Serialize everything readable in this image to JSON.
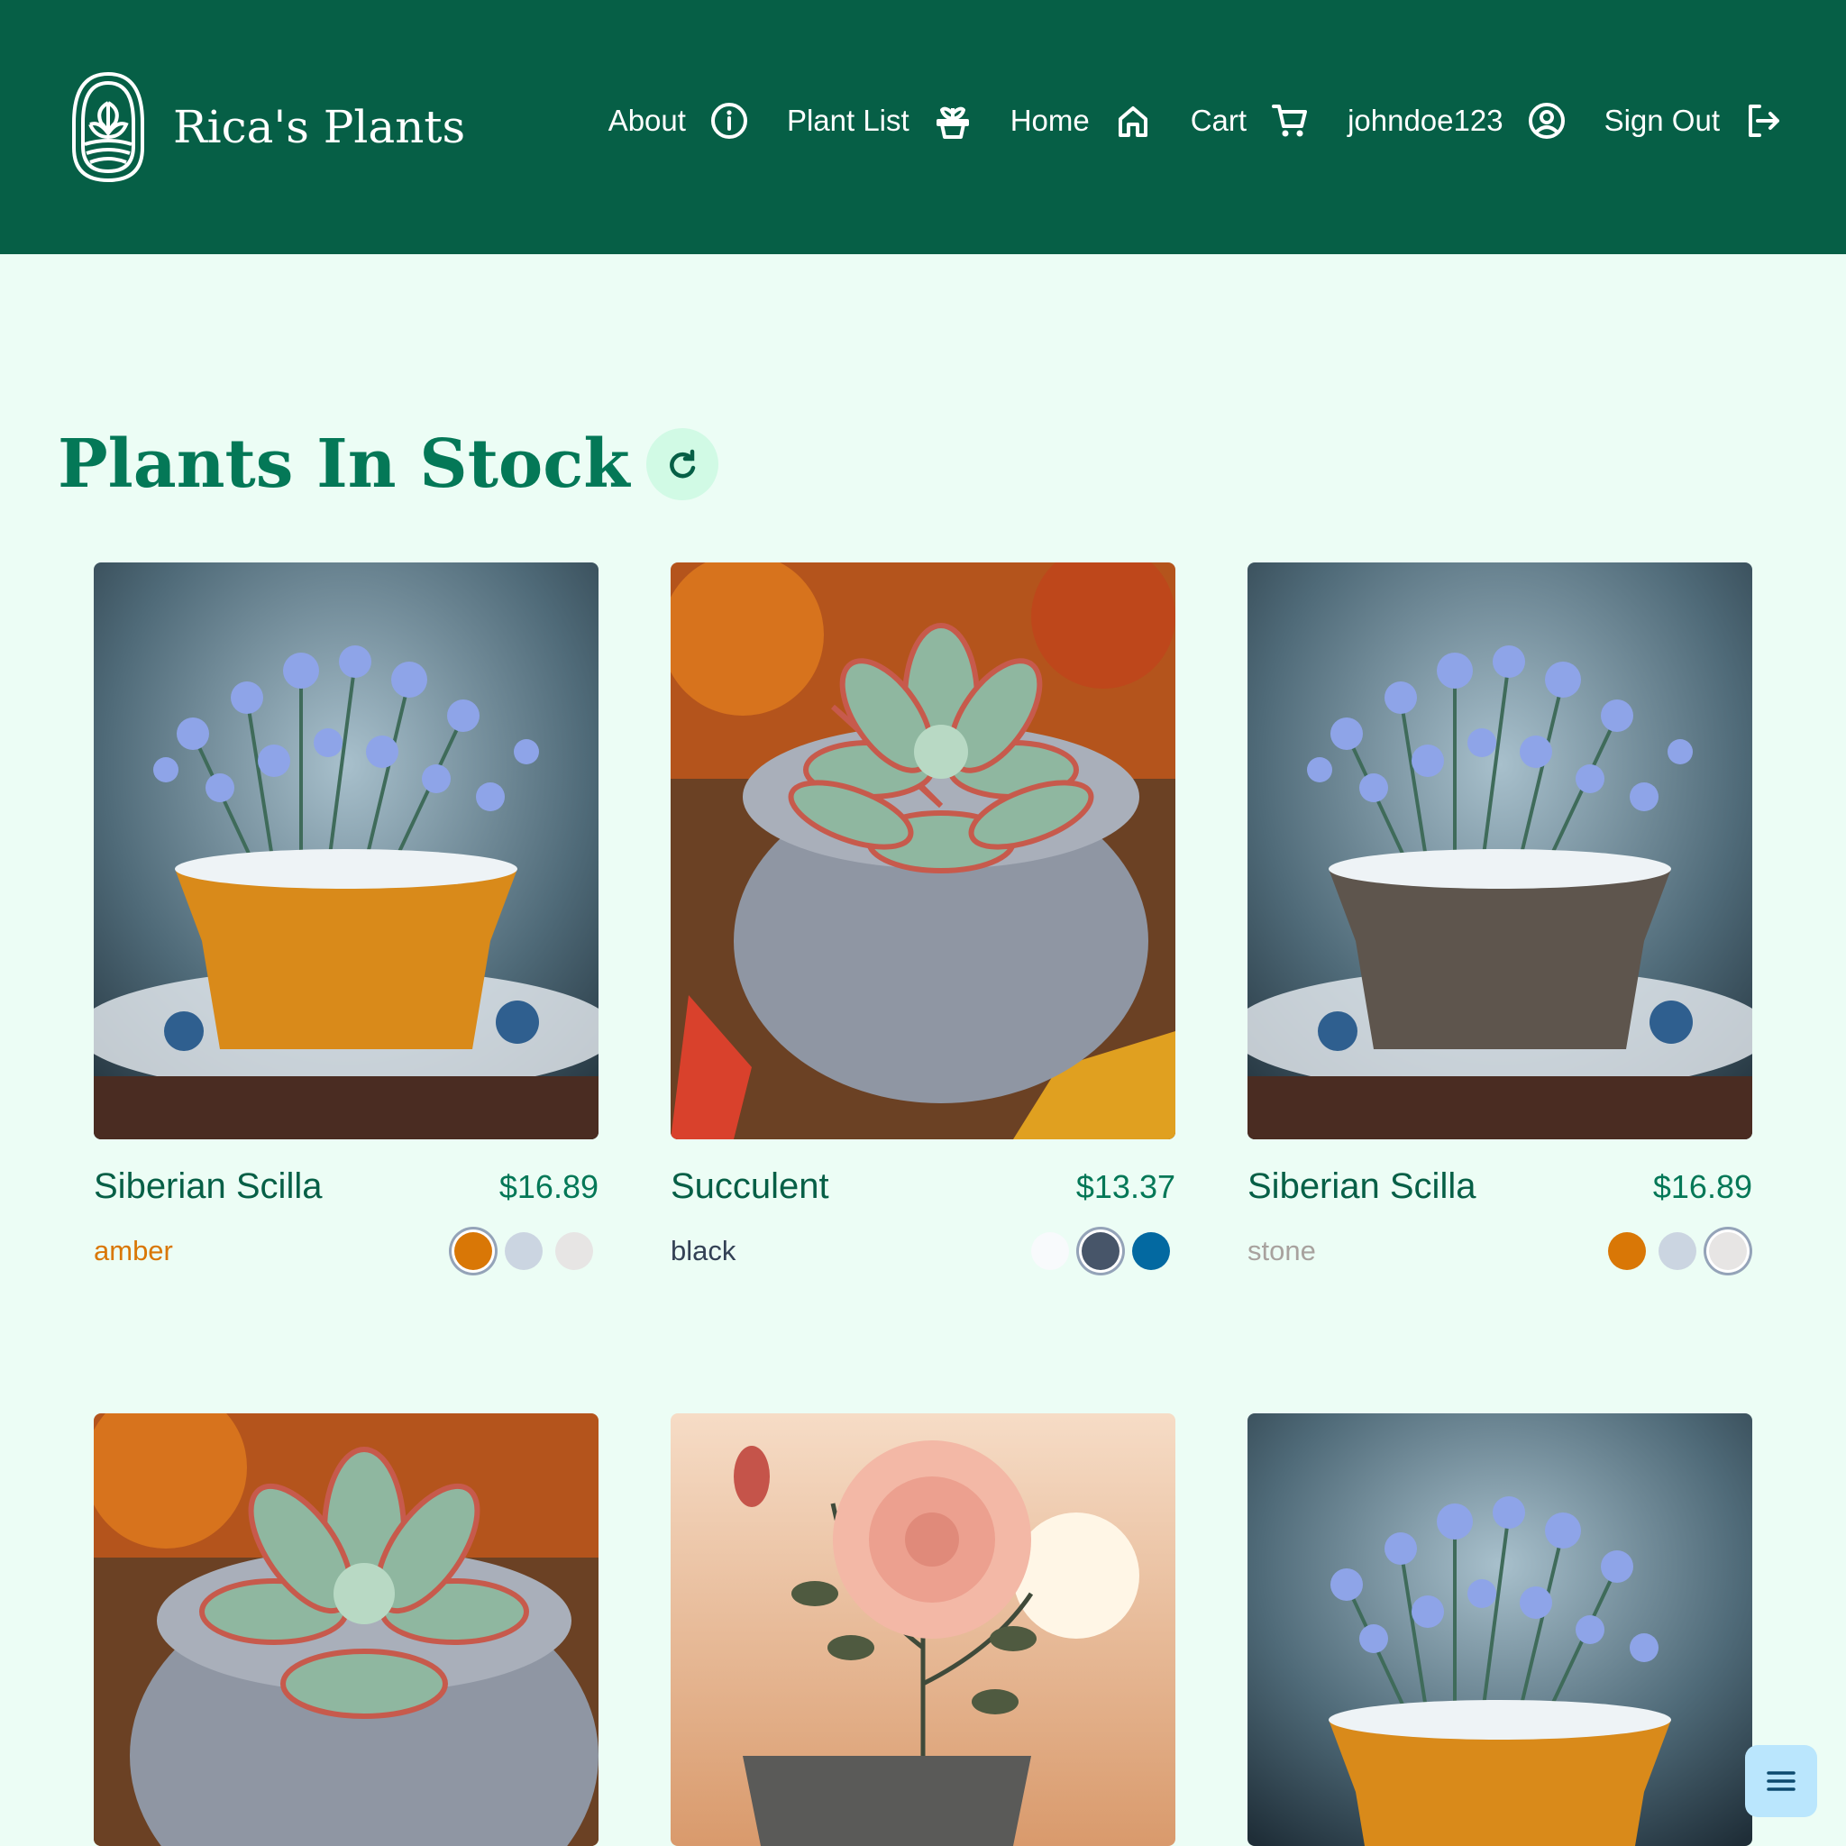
{
  "header": {
    "brand_name": "Rica's Plants",
    "nav": [
      {
        "label": "About",
        "icon": "info-icon"
      },
      {
        "label": "Plant List",
        "icon": "plant-pot-icon"
      },
      {
        "label": "Home",
        "icon": "home-icon"
      },
      {
        "label": "Cart",
        "icon": "cart-icon"
      },
      {
        "label": "johndoe123",
        "icon": "user-circle-icon"
      },
      {
        "label": "Sign Out",
        "icon": "sign-out-icon"
      }
    ]
  },
  "main": {
    "title": "Plants In Stock",
    "refresh_icon": "refresh-icon"
  },
  "cards": [
    {
      "name": "Siberian Scilla",
      "price": "$16.89",
      "color_label": "amber",
      "color_hex": "#d97706",
      "swatches": [
        "amber",
        "slate",
        "stone"
      ],
      "selected": "amber"
    },
    {
      "name": "Succulent",
      "price": "$13.37",
      "color_label": "black",
      "color_hex": "#475569",
      "swatches": [
        "white",
        "black",
        "blue"
      ],
      "selected": "black"
    },
    {
      "name": "Siberian Scilla",
      "price": "$16.89",
      "color_label": "stone",
      "color_hex": "#a8a29e",
      "swatches": [
        "amber",
        "slate",
        "stone"
      ],
      "selected": "stone"
    }
  ],
  "colors": {
    "header_bg": "#065f46",
    "page_bg": "#ecfdf5",
    "title": "#047857",
    "fab_bg": "#bae6fd"
  },
  "fab_icon": "menu-icon"
}
